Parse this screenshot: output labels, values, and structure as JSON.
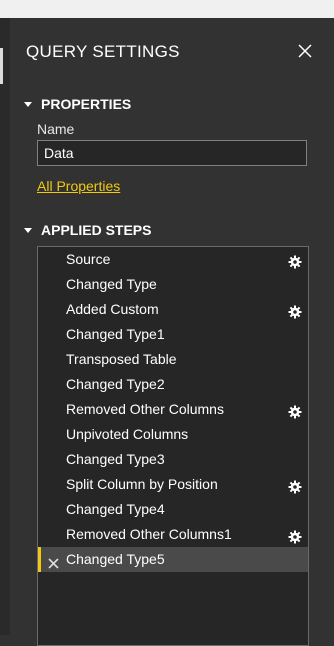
{
  "header": {
    "title": "QUERY SETTINGS",
    "close_icon": "close-icon"
  },
  "properties": {
    "section_title": "PROPERTIES",
    "name_label": "Name",
    "name_value": "Data",
    "all_properties_link": "All Properties"
  },
  "applied_steps": {
    "section_title": "APPLIED STEPS",
    "items": [
      {
        "label": "Source",
        "has_settings": true
      },
      {
        "label": "Changed Type",
        "has_settings": false
      },
      {
        "label": "Added Custom",
        "has_settings": true
      },
      {
        "label": "Changed Type1",
        "has_settings": false
      },
      {
        "label": "Transposed Table",
        "has_settings": false
      },
      {
        "label": "Changed Type2",
        "has_settings": false
      },
      {
        "label": "Removed Other Columns",
        "has_settings": true
      },
      {
        "label": "Unpivoted Columns",
        "has_settings": false
      },
      {
        "label": "Changed Type3",
        "has_settings": false
      },
      {
        "label": "Split Column by Position",
        "has_settings": true
      },
      {
        "label": "Changed Type4",
        "has_settings": false
      },
      {
        "label": "Removed Other Columns1",
        "has_settings": true
      },
      {
        "label": "Changed Type5",
        "has_settings": false,
        "selected": true
      }
    ]
  },
  "colors": {
    "accent": "#f2c811",
    "panel": "#323232",
    "list_bg": "#262626",
    "selected_bg": "#4a4a4a"
  }
}
